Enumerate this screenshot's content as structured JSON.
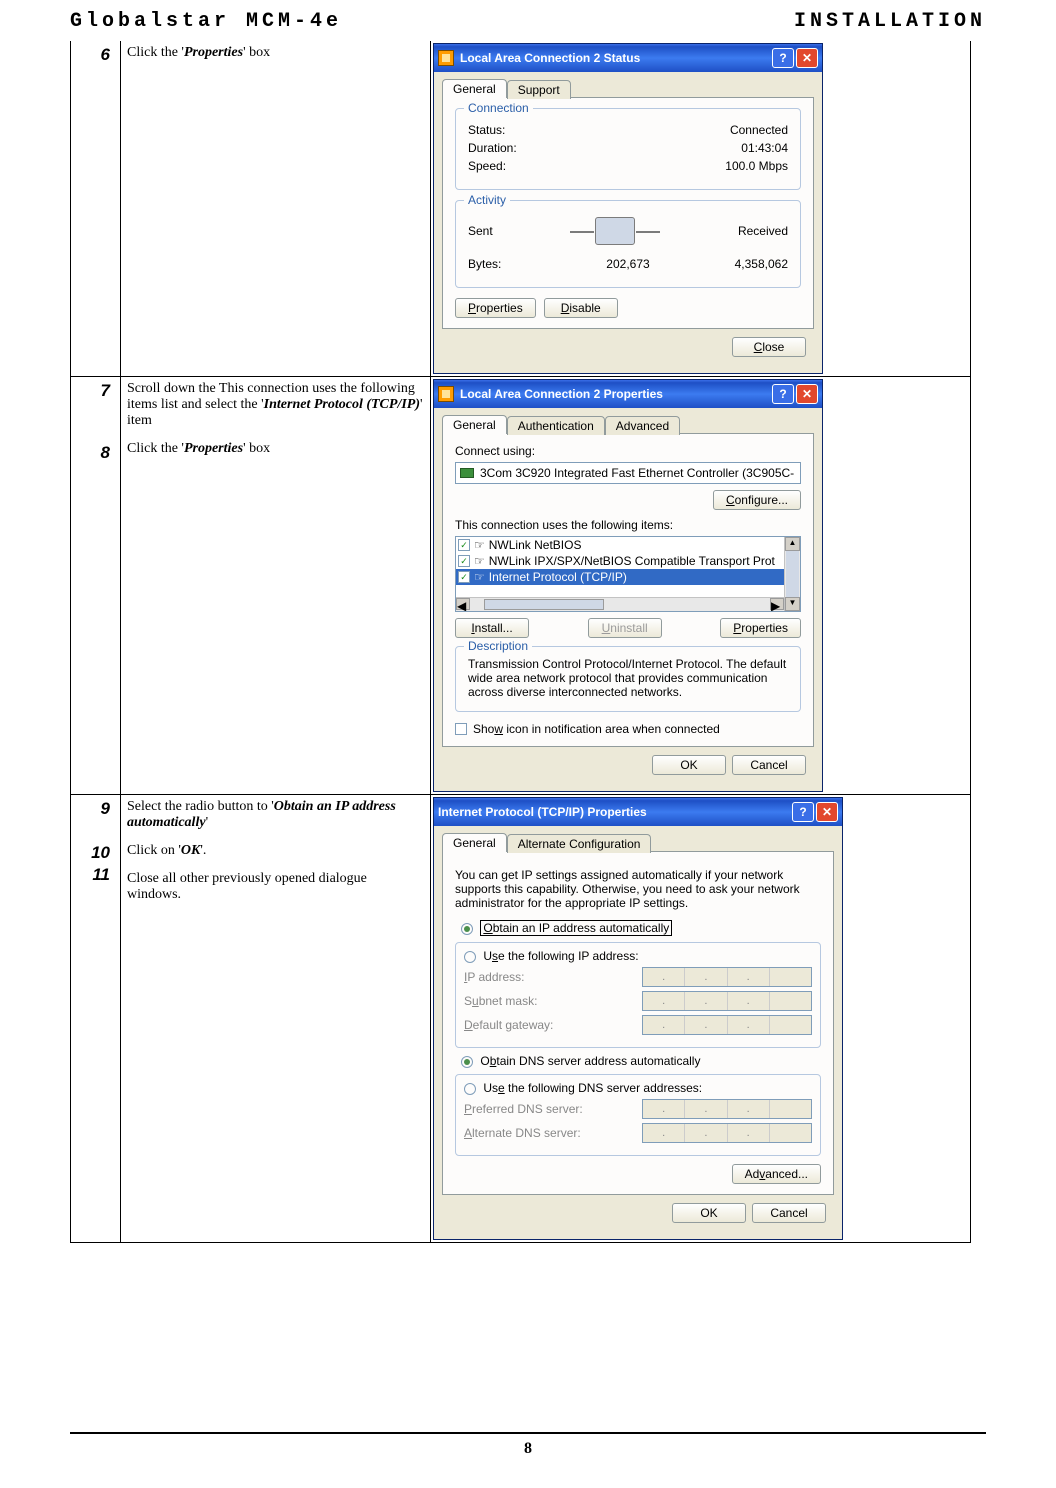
{
  "header": {
    "left": "Globalstar MCM-4e",
    "right": "INSTALLATION"
  },
  "page_number": "8",
  "steps": {
    "s6": {
      "num": "6",
      "pre": "Click the '",
      "em": "Properties",
      "post": "' box"
    },
    "s7": {
      "num": "7",
      "pre": "Scroll down the  This connection uses the following items list and select the '",
      "em": "Internet Protocol (TCP/IP)",
      "post": "' item"
    },
    "s8": {
      "num": "8",
      "pre": "Click the '",
      "em": "Properties",
      "post": "' box"
    },
    "s9": {
      "num": "9",
      "pre": "Select the radio button to '",
      "em": "Obtain an IP address automatically",
      "post": "'"
    },
    "s10": {
      "num": "10",
      "pre": "Click on '",
      "em": "OK",
      "post": "'."
    },
    "s11": {
      "num": "11",
      "text": "Close all other previously opened dialogue windows."
    }
  },
  "dlg_status": {
    "title": "Local Area Connection 2 Status",
    "tabs": {
      "general": "General",
      "support": "Support"
    },
    "connection_legend": "Connection",
    "status_lbl": "Status:",
    "status_val": "Connected",
    "duration_lbl": "Duration:",
    "duration_val": "01:43:04",
    "speed_lbl": "Speed:",
    "speed_val": "100.0 Mbps",
    "activity_legend": "Activity",
    "sent": "Sent",
    "received": "Received",
    "bytes_lbl": "Bytes:",
    "bytes_sent": "202,673",
    "bytes_recv": "4,358,062",
    "btn_properties": "Properties",
    "btn_disable": "Disable",
    "btn_close": "Close"
  },
  "dlg_props": {
    "title": "Local Area Connection 2 Properties",
    "tabs": {
      "general": "General",
      "auth": "Authentication",
      "adv": "Advanced"
    },
    "connect_using": "Connect using:",
    "nic": "3Com 3C920 Integrated Fast Ethernet Controller (3C905C-",
    "btn_configure": "Configure...",
    "items_lbl": "This connection uses the following items:",
    "item1": "NWLink NetBIOS",
    "item2": "NWLink IPX/SPX/NetBIOS Compatible Transport Prot",
    "item3": "Internet Protocol (TCP/IP)",
    "btn_install": "Install...",
    "btn_uninstall": "Uninstall",
    "btn_props": "Properties",
    "desc_legend": "Description",
    "desc_text": "Transmission Control Protocol/Internet Protocol. The default wide area network protocol that provides communication across diverse interconnected networks.",
    "show_icon": "Show icon in notification area when connected",
    "btn_ok": "OK",
    "btn_cancel": "Cancel"
  },
  "dlg_tcp": {
    "title": "Internet Protocol (TCP/IP) Properties",
    "tabs": {
      "general": "General",
      "alt": "Alternate Configuration"
    },
    "intro": "You can get IP settings assigned automatically if your network supports this capability. Otherwise, you need to ask your network administrator for the appropriate IP settings.",
    "r_auto_ip": "Obtain an IP address automatically",
    "r_use_ip": "Use the following IP address:",
    "ip_lbl": "IP address:",
    "mask_lbl": "Subnet mask:",
    "gw_lbl": "Default gateway:",
    "r_auto_dns": "Obtain DNS server address automatically",
    "r_use_dns": "Use the following DNS server addresses:",
    "pdns_lbl": "Preferred DNS server:",
    "adns_lbl": "Alternate DNS server:",
    "btn_advanced": "Advanced...",
    "btn_ok": "OK",
    "btn_cancel": "Cancel"
  }
}
